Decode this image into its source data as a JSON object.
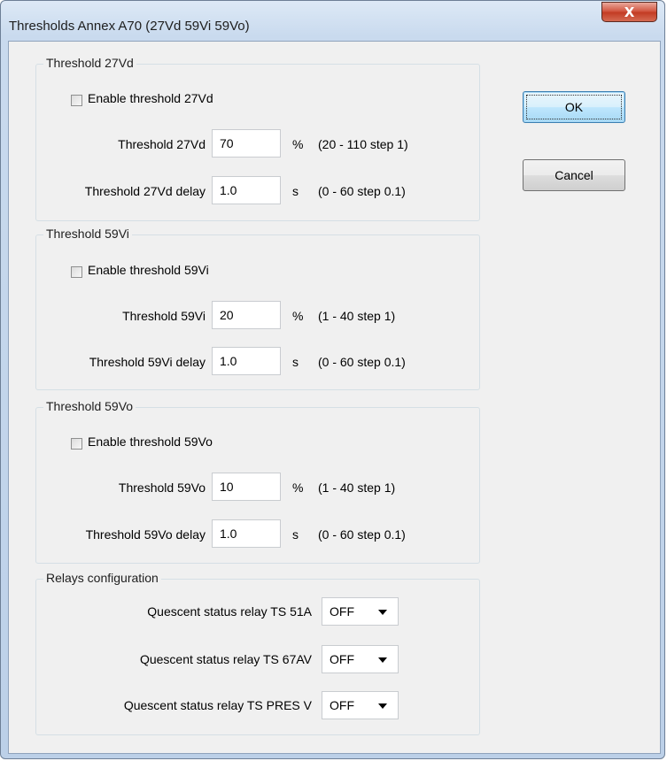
{
  "window": {
    "title": "Thresholds Annex A70 (27Vd 59Vi 59Vo)",
    "close_glyph": "X"
  },
  "buttons": {
    "ok": "OK",
    "cancel": "Cancel"
  },
  "groups": {
    "g27vd": {
      "legend": "Threshold 27Vd",
      "enable_label": "Enable threshold 27Vd",
      "threshold_label": "Threshold 27Vd",
      "threshold_value": "70",
      "threshold_unit": "%",
      "threshold_range": "(20 - 110 step 1)",
      "delay_label": "Threshold 27Vd delay",
      "delay_value": "1.0",
      "delay_unit": "s",
      "delay_range": "(0 - 60 step 0.1)"
    },
    "g59vi": {
      "legend": "Threshold 59Vi",
      "enable_label": "Enable threshold 59Vi",
      "threshold_label": "Threshold 59Vi",
      "threshold_value": "20",
      "threshold_unit": "%",
      "threshold_range": "(1 - 40 step 1)",
      "delay_label": "Threshold 59Vi delay",
      "delay_value": "1.0",
      "delay_unit": "s",
      "delay_range": "(0 - 60 step 0.1)"
    },
    "g59vo": {
      "legend": "Threshold 59Vo",
      "enable_label": "Enable threshold 59Vo",
      "threshold_label": "Threshold 59Vo",
      "threshold_value": "10",
      "threshold_unit": "%",
      "threshold_range": "(1 - 40 step 1)",
      "delay_label": "Threshold 59Vo delay",
      "delay_value": "1.0",
      "delay_unit": "s",
      "delay_range": "(0 - 60 step 0.1)"
    },
    "relays": {
      "legend": "Relays configuration",
      "items": [
        {
          "label": "Quescent status relay TS 51A",
          "value": "OFF"
        },
        {
          "label": "Quescent status relay TS 67AV",
          "value": "OFF"
        },
        {
          "label": "Quescent status relay TS PRES V",
          "value": "OFF"
        }
      ]
    }
  }
}
